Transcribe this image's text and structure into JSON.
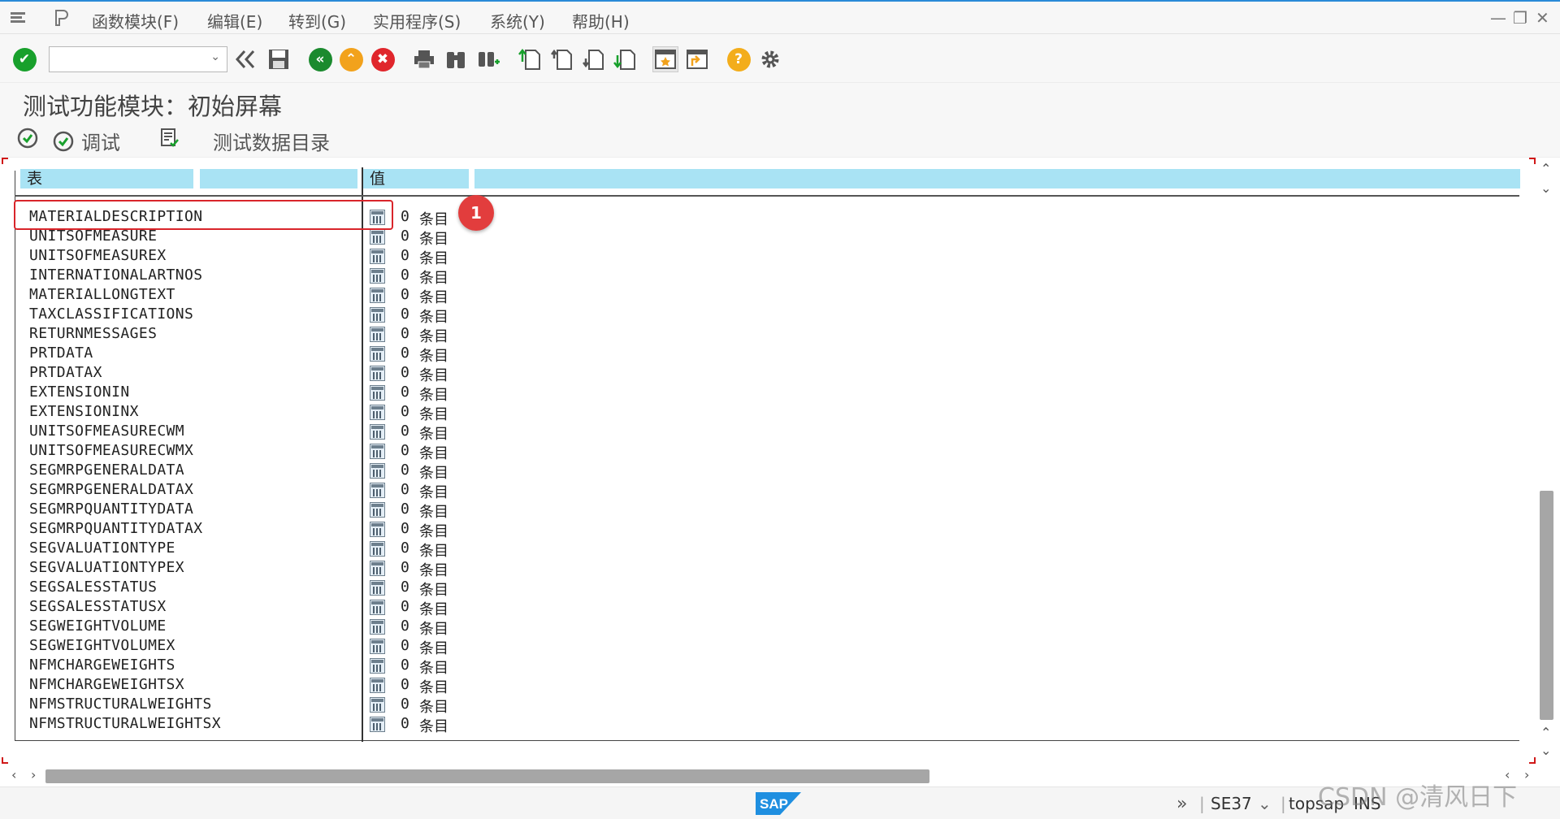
{
  "menubar": {
    "items": [
      "函数模块(F)",
      "编辑(E)",
      "转到(G)",
      "实用程序(S)",
      "系统(Y)",
      "帮助(H)"
    ]
  },
  "toolbar": {
    "command_field_value": ""
  },
  "title": "测试功能模块：初始屏幕",
  "app_toolbar": {
    "debug_label": "调试",
    "test_data_dir_label": "测试数据目录"
  },
  "table": {
    "col_table": "表",
    "col_value": "值",
    "rows": [
      {
        "name": "MATERIALDESCRIPTION",
        "count": "0",
        "unit": "条目"
      },
      {
        "name": "UNITSOFMEASURE",
        "count": "0",
        "unit": "条目"
      },
      {
        "name": "UNITSOFMEASUREX",
        "count": "0",
        "unit": "条目"
      },
      {
        "name": "INTERNATIONALARTNOS",
        "count": "0",
        "unit": "条目"
      },
      {
        "name": "MATERIALLONGTEXT",
        "count": "0",
        "unit": "条目"
      },
      {
        "name": "TAXCLASSIFICATIONS",
        "count": "0",
        "unit": "条目"
      },
      {
        "name": "RETURNMESSAGES",
        "count": "0",
        "unit": "条目"
      },
      {
        "name": "PRTDATA",
        "count": "0",
        "unit": "条目"
      },
      {
        "name": "PRTDATAX",
        "count": "0",
        "unit": "条目"
      },
      {
        "name": "EXTENSIONIN",
        "count": "0",
        "unit": "条目"
      },
      {
        "name": "EXTENSIONINX",
        "count": "0",
        "unit": "条目"
      },
      {
        "name": "UNITSOFMEASURECWM",
        "count": "0",
        "unit": "条目"
      },
      {
        "name": "UNITSOFMEASURECWMX",
        "count": "0",
        "unit": "条目"
      },
      {
        "name": "SEGMRPGENERALDATA",
        "count": "0",
        "unit": "条目"
      },
      {
        "name": "SEGMRPGENERALDATAX",
        "count": "0",
        "unit": "条目"
      },
      {
        "name": "SEGMRPQUANTITYDATA",
        "count": "0",
        "unit": "条目"
      },
      {
        "name": "SEGMRPQUANTITYDATAX",
        "count": "0",
        "unit": "条目"
      },
      {
        "name": "SEGVALUATIONTYPE",
        "count": "0",
        "unit": "条目"
      },
      {
        "name": "SEGVALUATIONTYPEX",
        "count": "0",
        "unit": "条目"
      },
      {
        "name": "SEGSALESSTATUS",
        "count": "0",
        "unit": "条目"
      },
      {
        "name": "SEGSALESSTATUSX",
        "count": "0",
        "unit": "条目"
      },
      {
        "name": "SEGWEIGHTVOLUME",
        "count": "0",
        "unit": "条目"
      },
      {
        "name": "SEGWEIGHTVOLUMEX",
        "count": "0",
        "unit": "条目"
      },
      {
        "name": "NFMCHARGEWEIGHTS",
        "count": "0",
        "unit": "条目"
      },
      {
        "name": "NFMCHARGEWEIGHTSX",
        "count": "0",
        "unit": "条目"
      },
      {
        "name": "NFMSTRUCTURALWEIGHTS",
        "count": "0",
        "unit": "条目"
      },
      {
        "name": "NFMSTRUCTURALWEIGHTSX",
        "count": "0",
        "unit": "条目"
      }
    ]
  },
  "annotation": {
    "marker_label": "1"
  },
  "statusbar": {
    "transaction": "SE37",
    "server": "topsap",
    "mode": "INS"
  },
  "watermark": "CSDN @清风日下",
  "colors": {
    "accent": "#2a8ad8",
    "header_cyan": "#a9e3f4",
    "highlight_red": "#d9252b",
    "ok_green": "#18a02c",
    "back_green": "#1b8a2e",
    "up_orange": "#f2a21c",
    "cancel_red": "#e0262c",
    "help_yellow": "#f3ad1b"
  }
}
